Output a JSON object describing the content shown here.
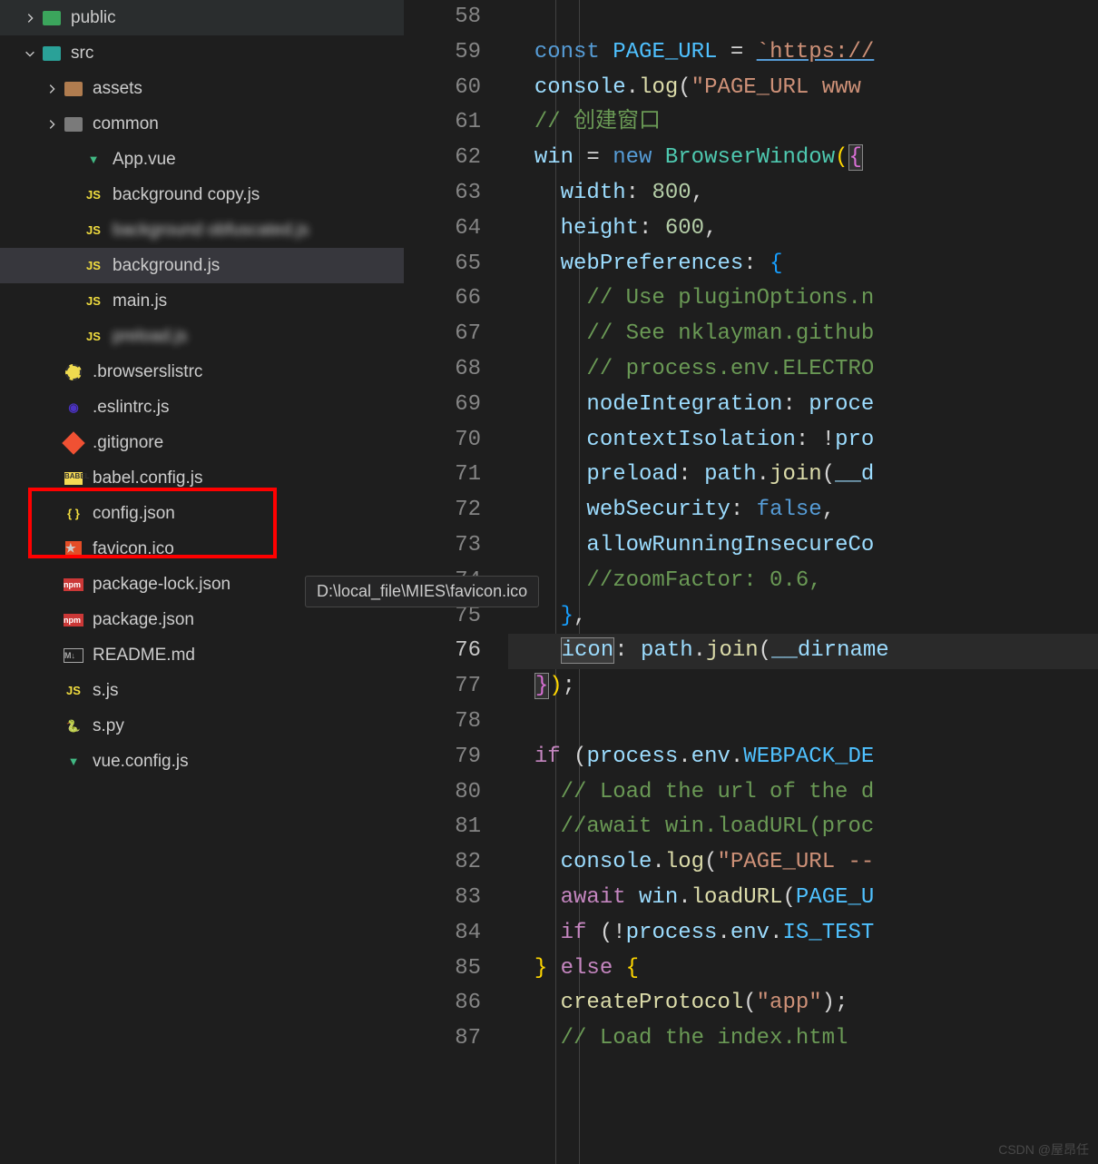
{
  "tooltip": "D:\\local_file\\MIES\\favicon.ico",
  "watermark": "CSDN @屋昂任",
  "sidebar": {
    "items": [
      {
        "indent": 24,
        "chevron": "right",
        "icon": "folder-public",
        "label": "public"
      },
      {
        "indent": 24,
        "chevron": "down",
        "icon": "folder-src",
        "label": "src"
      },
      {
        "indent": 48,
        "chevron": "right",
        "icon": "folder-assets",
        "label": "assets"
      },
      {
        "indent": 48,
        "chevron": "right",
        "icon": "folder-common",
        "label": "common"
      },
      {
        "indent": 70,
        "chevron": "",
        "icon": "vue",
        "label": "App.vue"
      },
      {
        "indent": 70,
        "chevron": "",
        "icon": "js",
        "label": "background copy.js"
      },
      {
        "indent": 70,
        "chevron": "",
        "icon": "js",
        "label": "background obfuscated.js",
        "blurred": true
      },
      {
        "indent": 70,
        "chevron": "",
        "icon": "js",
        "label": "background.js",
        "selected": true
      },
      {
        "indent": 70,
        "chevron": "",
        "icon": "js",
        "label": "main.js"
      },
      {
        "indent": 70,
        "chevron": "",
        "icon": "js",
        "label": "preload.js",
        "blurred": true
      },
      {
        "indent": 48,
        "chevron": "",
        "icon": "browserslist",
        "label": ".browserslistrc"
      },
      {
        "indent": 48,
        "chevron": "",
        "icon": "eslint",
        "label": ".eslintrc.js"
      },
      {
        "indent": 48,
        "chevron": "",
        "icon": "git",
        "label": ".gitignore"
      },
      {
        "indent": 48,
        "chevron": "",
        "icon": "babel",
        "label": "babel.config.js"
      },
      {
        "indent": 48,
        "chevron": "",
        "icon": "json",
        "label": "config.json"
      },
      {
        "indent": 48,
        "chevron": "",
        "icon": "favicon",
        "label": "favicon.ico"
      },
      {
        "indent": 48,
        "chevron": "",
        "icon": "npm",
        "label": "package-lock.json"
      },
      {
        "indent": 48,
        "chevron": "",
        "icon": "npm",
        "label": "package.json"
      },
      {
        "indent": 48,
        "chevron": "",
        "icon": "md",
        "label": "README.md"
      },
      {
        "indent": 48,
        "chevron": "",
        "icon": "js",
        "label": "s.js"
      },
      {
        "indent": 48,
        "chevron": "",
        "icon": "py",
        "label": "s.py"
      },
      {
        "indent": 48,
        "chevron": "",
        "icon": "vue",
        "label": "vue.config.js"
      }
    ]
  },
  "editor": {
    "current_line": 76,
    "lines": [
      {
        "n": 58,
        "tokens": []
      },
      {
        "n": 59,
        "tokens": [
          {
            "t": "  ",
            "c": "op"
          },
          {
            "t": "const",
            "c": "const"
          },
          {
            "t": " ",
            "c": "op"
          },
          {
            "t": "PAGE_URL",
            "c": "var"
          },
          {
            "t": " = ",
            "c": "op"
          },
          {
            "t": "`https://",
            "c": "str underline-link"
          }
        ]
      },
      {
        "n": 60,
        "tokens": [
          {
            "t": "  ",
            "c": "op"
          },
          {
            "t": "console",
            "c": "prop"
          },
          {
            "t": ".",
            "c": "op"
          },
          {
            "t": "log",
            "c": "fn"
          },
          {
            "t": "(",
            "c": "paren"
          },
          {
            "t": "\"PAGE_URL www",
            "c": "str"
          }
        ]
      },
      {
        "n": 61,
        "tokens": [
          {
            "t": "  ",
            "c": "op"
          },
          {
            "t": "// 创建窗口",
            "c": "comment"
          }
        ]
      },
      {
        "n": 62,
        "tokens": [
          {
            "t": "  ",
            "c": "op"
          },
          {
            "t": "win",
            "c": "prop"
          },
          {
            "t": " = ",
            "c": "op"
          },
          {
            "t": "new",
            "c": "const"
          },
          {
            "t": " ",
            "c": "op"
          },
          {
            "t": "BrowserWindow",
            "c": "cls"
          },
          {
            "t": "(",
            "c": "brace1"
          },
          {
            "t": "{",
            "c": "brace2 bracket-match"
          }
        ]
      },
      {
        "n": 63,
        "tokens": [
          {
            "t": "    ",
            "c": "op"
          },
          {
            "t": "width",
            "c": "prop"
          },
          {
            "t": ": ",
            "c": "op"
          },
          {
            "t": "800",
            "c": "num"
          },
          {
            "t": ",",
            "c": "op"
          }
        ]
      },
      {
        "n": 64,
        "tokens": [
          {
            "t": "    ",
            "c": "op"
          },
          {
            "t": "height",
            "c": "prop"
          },
          {
            "t": ": ",
            "c": "op"
          },
          {
            "t": "600",
            "c": "num"
          },
          {
            "t": ",",
            "c": "op"
          }
        ]
      },
      {
        "n": 65,
        "tokens": [
          {
            "t": "    ",
            "c": "op"
          },
          {
            "t": "webPreferences",
            "c": "prop"
          },
          {
            "t": ": ",
            "c": "op"
          },
          {
            "t": "{",
            "c": "brace3"
          }
        ]
      },
      {
        "n": 66,
        "tokens": [
          {
            "t": "      ",
            "c": "op"
          },
          {
            "t": "// Use pluginOptions.n",
            "c": "comment"
          }
        ]
      },
      {
        "n": 67,
        "tokens": [
          {
            "t": "      ",
            "c": "op"
          },
          {
            "t": "// See nklayman.github",
            "c": "comment"
          }
        ]
      },
      {
        "n": 68,
        "tokens": [
          {
            "t": "      ",
            "c": "op"
          },
          {
            "t": "// process.env.ELECTRO",
            "c": "comment"
          }
        ]
      },
      {
        "n": 69,
        "tokens": [
          {
            "t": "      ",
            "c": "op"
          },
          {
            "t": "nodeIntegration",
            "c": "prop"
          },
          {
            "t": ": ",
            "c": "op"
          },
          {
            "t": "proce",
            "c": "prop"
          }
        ]
      },
      {
        "n": 70,
        "tokens": [
          {
            "t": "      ",
            "c": "op"
          },
          {
            "t": "contextIsolation",
            "c": "prop"
          },
          {
            "t": ": !",
            "c": "op"
          },
          {
            "t": "pro",
            "c": "prop"
          }
        ]
      },
      {
        "n": 71,
        "tokens": [
          {
            "t": "      ",
            "c": "op"
          },
          {
            "t": "preload",
            "c": "prop"
          },
          {
            "t": ": ",
            "c": "op"
          },
          {
            "t": "path",
            "c": "prop"
          },
          {
            "t": ".",
            "c": "op"
          },
          {
            "t": "join",
            "c": "fn"
          },
          {
            "t": "(",
            "c": "paren"
          },
          {
            "t": "__d",
            "c": "prop"
          }
        ]
      },
      {
        "n": 72,
        "tokens": [
          {
            "t": "      ",
            "c": "op"
          },
          {
            "t": "webSecurity",
            "c": "prop"
          },
          {
            "t": ": ",
            "c": "op"
          },
          {
            "t": "false",
            "c": "const"
          },
          {
            "t": ",",
            "c": "op"
          }
        ]
      },
      {
        "n": 73,
        "tokens": [
          {
            "t": "      ",
            "c": "op"
          },
          {
            "t": "allowRunningInsecureCo",
            "c": "prop"
          }
        ]
      },
      {
        "n": 74,
        "tokens": [
          {
            "t": "      ",
            "c": "op"
          },
          {
            "t": "//zoomFactor: 0.6,",
            "c": "comment"
          }
        ]
      },
      {
        "n": 75,
        "tokens": [
          {
            "t": "    ",
            "c": "op"
          },
          {
            "t": "}",
            "c": "brace3"
          },
          {
            "t": ",",
            "c": "op"
          }
        ]
      },
      {
        "n": 76,
        "tokens": [
          {
            "t": "    ",
            "c": "op"
          },
          {
            "t": "icon",
            "c": "prop bracket-match"
          },
          {
            "t": ": ",
            "c": "op"
          },
          {
            "t": "path",
            "c": "prop"
          },
          {
            "t": ".",
            "c": "op"
          },
          {
            "t": "join",
            "c": "fn"
          },
          {
            "t": "(",
            "c": "paren"
          },
          {
            "t": "__dirname",
            "c": "prop"
          }
        ]
      },
      {
        "n": 77,
        "tokens": [
          {
            "t": "  ",
            "c": "op"
          },
          {
            "t": "}",
            "c": "brace2 bracket-match"
          },
          {
            "t": ")",
            "c": "brace1"
          },
          {
            "t": ";",
            "c": "op"
          }
        ]
      },
      {
        "n": 78,
        "tokens": []
      },
      {
        "n": 79,
        "tokens": [
          {
            "t": "  ",
            "c": "op"
          },
          {
            "t": "if",
            "c": "kw"
          },
          {
            "t": " (",
            "c": "paren"
          },
          {
            "t": "process",
            "c": "prop"
          },
          {
            "t": ".",
            "c": "op"
          },
          {
            "t": "env",
            "c": "prop"
          },
          {
            "t": ".",
            "c": "op"
          },
          {
            "t": "WEBPACK_DE",
            "c": "var"
          }
        ]
      },
      {
        "n": 80,
        "tokens": [
          {
            "t": "    ",
            "c": "op"
          },
          {
            "t": "// Load the url of the d",
            "c": "comment"
          }
        ]
      },
      {
        "n": 81,
        "tokens": [
          {
            "t": "    ",
            "c": "op"
          },
          {
            "t": "//await win.loadURL(proc",
            "c": "comment"
          }
        ]
      },
      {
        "n": 82,
        "tokens": [
          {
            "t": "    ",
            "c": "op"
          },
          {
            "t": "console",
            "c": "prop"
          },
          {
            "t": ".",
            "c": "op"
          },
          {
            "t": "log",
            "c": "fn"
          },
          {
            "t": "(",
            "c": "paren"
          },
          {
            "t": "\"PAGE_URL --",
            "c": "str"
          }
        ]
      },
      {
        "n": 83,
        "tokens": [
          {
            "t": "    ",
            "c": "op"
          },
          {
            "t": "await",
            "c": "kw"
          },
          {
            "t": " ",
            "c": "op"
          },
          {
            "t": "win",
            "c": "prop"
          },
          {
            "t": ".",
            "c": "op"
          },
          {
            "t": "loadURL",
            "c": "fn"
          },
          {
            "t": "(",
            "c": "paren"
          },
          {
            "t": "PAGE_U",
            "c": "var"
          }
        ]
      },
      {
        "n": 84,
        "tokens": [
          {
            "t": "    ",
            "c": "op"
          },
          {
            "t": "if",
            "c": "kw"
          },
          {
            "t": " (!",
            "c": "op"
          },
          {
            "t": "process",
            "c": "prop"
          },
          {
            "t": ".",
            "c": "op"
          },
          {
            "t": "env",
            "c": "prop"
          },
          {
            "t": ".",
            "c": "op"
          },
          {
            "t": "IS_TEST",
            "c": "var"
          }
        ]
      },
      {
        "n": 85,
        "tokens": [
          {
            "t": "  ",
            "c": "op"
          },
          {
            "t": "}",
            "c": "brace1"
          },
          {
            "t": " ",
            "c": "op"
          },
          {
            "t": "else",
            "c": "kw"
          },
          {
            "t": " ",
            "c": "op"
          },
          {
            "t": "{",
            "c": "brace1"
          }
        ]
      },
      {
        "n": 86,
        "tokens": [
          {
            "t": "    ",
            "c": "op"
          },
          {
            "t": "createProtocol",
            "c": "fn"
          },
          {
            "t": "(",
            "c": "paren"
          },
          {
            "t": "\"app\"",
            "c": "str"
          },
          {
            "t": ")",
            "c": "paren"
          },
          {
            "t": ";",
            "c": "op"
          }
        ]
      },
      {
        "n": 87,
        "tokens": [
          {
            "t": "    ",
            "c": "op"
          },
          {
            "t": "// Load the index.html",
            "c": "comment"
          }
        ]
      }
    ]
  }
}
